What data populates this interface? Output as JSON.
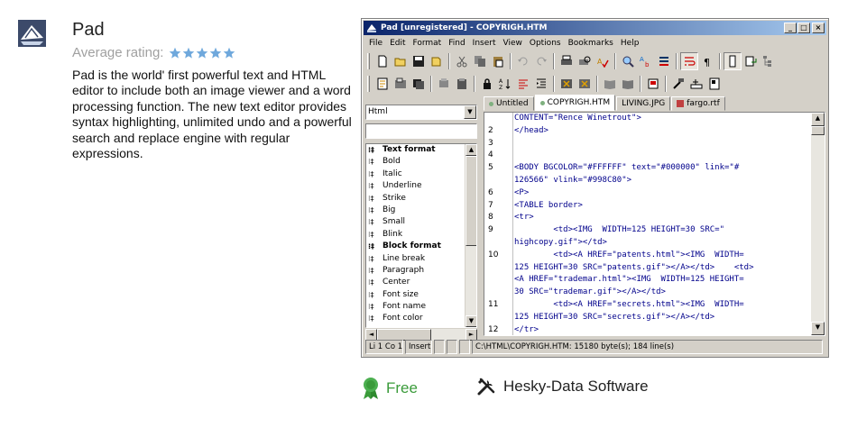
{
  "listing": {
    "title": "Pad",
    "rating_label": "Average rating:",
    "rating_stars": 5,
    "description": "Pad is the world' first powerful text and HTML editor to include both an image viewer and a word processing function. The new text editor provides syntax highlighting, unlimited undo and a powerful search and replace engine with regular expressions.",
    "license": "Free",
    "developer": "Hesky-Data Software"
  },
  "window": {
    "title": "Pad [unregistered] - COPYRIGH.HTM",
    "menu": [
      "File",
      "Edit",
      "Format",
      "Find",
      "Insert",
      "View",
      "Options",
      "Bookmarks",
      "Help"
    ],
    "syntax_select": "Html",
    "tag_list": [
      {
        "label": "Text format",
        "bold": true
      },
      {
        "label": "Bold",
        "bold": false
      },
      {
        "label": "Italic",
        "bold": false
      },
      {
        "label": "Underline",
        "bold": false
      },
      {
        "label": "Strike",
        "bold": false
      },
      {
        "label": "Big",
        "bold": false
      },
      {
        "label": "Small",
        "bold": false
      },
      {
        "label": "Blink",
        "bold": false
      },
      {
        "label": "Block format",
        "bold": true
      },
      {
        "label": "Line break",
        "bold": false
      },
      {
        "label": "Paragraph",
        "bold": false
      },
      {
        "label": "Center",
        "bold": false
      },
      {
        "label": "Font size",
        "bold": false
      },
      {
        "label": "Font name",
        "bold": false
      },
      {
        "label": "Font color",
        "bold": false
      }
    ],
    "tabs": [
      "Untitled",
      "COPYRIGH.HTM",
      "LIVING.JPG",
      "fargo.rtf"
    ],
    "active_tab": 1,
    "code_lines": [
      {
        "n": "",
        "t": "CONTENT=\"Rence Winetrout\">"
      },
      {
        "n": "2",
        "t": "</head>"
      },
      {
        "n": "3",
        "t": ""
      },
      {
        "n": "4",
        "t": ""
      },
      {
        "n": "5",
        "t": "<BODY BGCOLOR=\"#FFFFFF\" text=\"#000000\" link=\"#"
      },
      {
        "n": "",
        "t": "126566\" vlink=\"#998C80\">"
      },
      {
        "n": "6",
        "t": "<P>"
      },
      {
        "n": "7",
        "t": "<TABLE border>"
      },
      {
        "n": "8",
        "t": "<tr>"
      },
      {
        "n": "9",
        "t": "        <td><IMG  WIDTH=125 HEIGHT=30 SRC=\""
      },
      {
        "n": "",
        "t": "highcopy.gif\"></td>"
      },
      {
        "n": "10",
        "t": "        <td><A HREF=\"patents.html\"><IMG  WIDTH="
      },
      {
        "n": "",
        "t": "125 HEIGHT=30 SRC=\"patents.gif\"></A></td>    <td>"
      },
      {
        "n": "",
        "t": "<A HREF=\"trademar.html\"><IMG  WIDTH=125 HEIGHT="
      },
      {
        "n": "",
        "t": "30 SRC=\"trademar.gif\"></A></td>"
      },
      {
        "n": "11",
        "t": "        <td><A HREF=\"secrets.html\"><IMG  WIDTH="
      },
      {
        "n": "",
        "t": "125 HEIGHT=30 SRC=\"secrets.gif\"></A></td>"
      },
      {
        "n": "12",
        "t": "</tr>"
      }
    ],
    "status": {
      "position": "Li 1 Co 1",
      "mode": "Insert",
      "file_info": "C:\\HTML\\COPYRIGH.HTM: 15180 byte(s); 184 line(s)"
    }
  },
  "colors": {
    "star": "#6fa8dc",
    "free_green": "#3a9b3a",
    "title_bar_start": "#0a246a",
    "code_tag": "#00008b"
  }
}
